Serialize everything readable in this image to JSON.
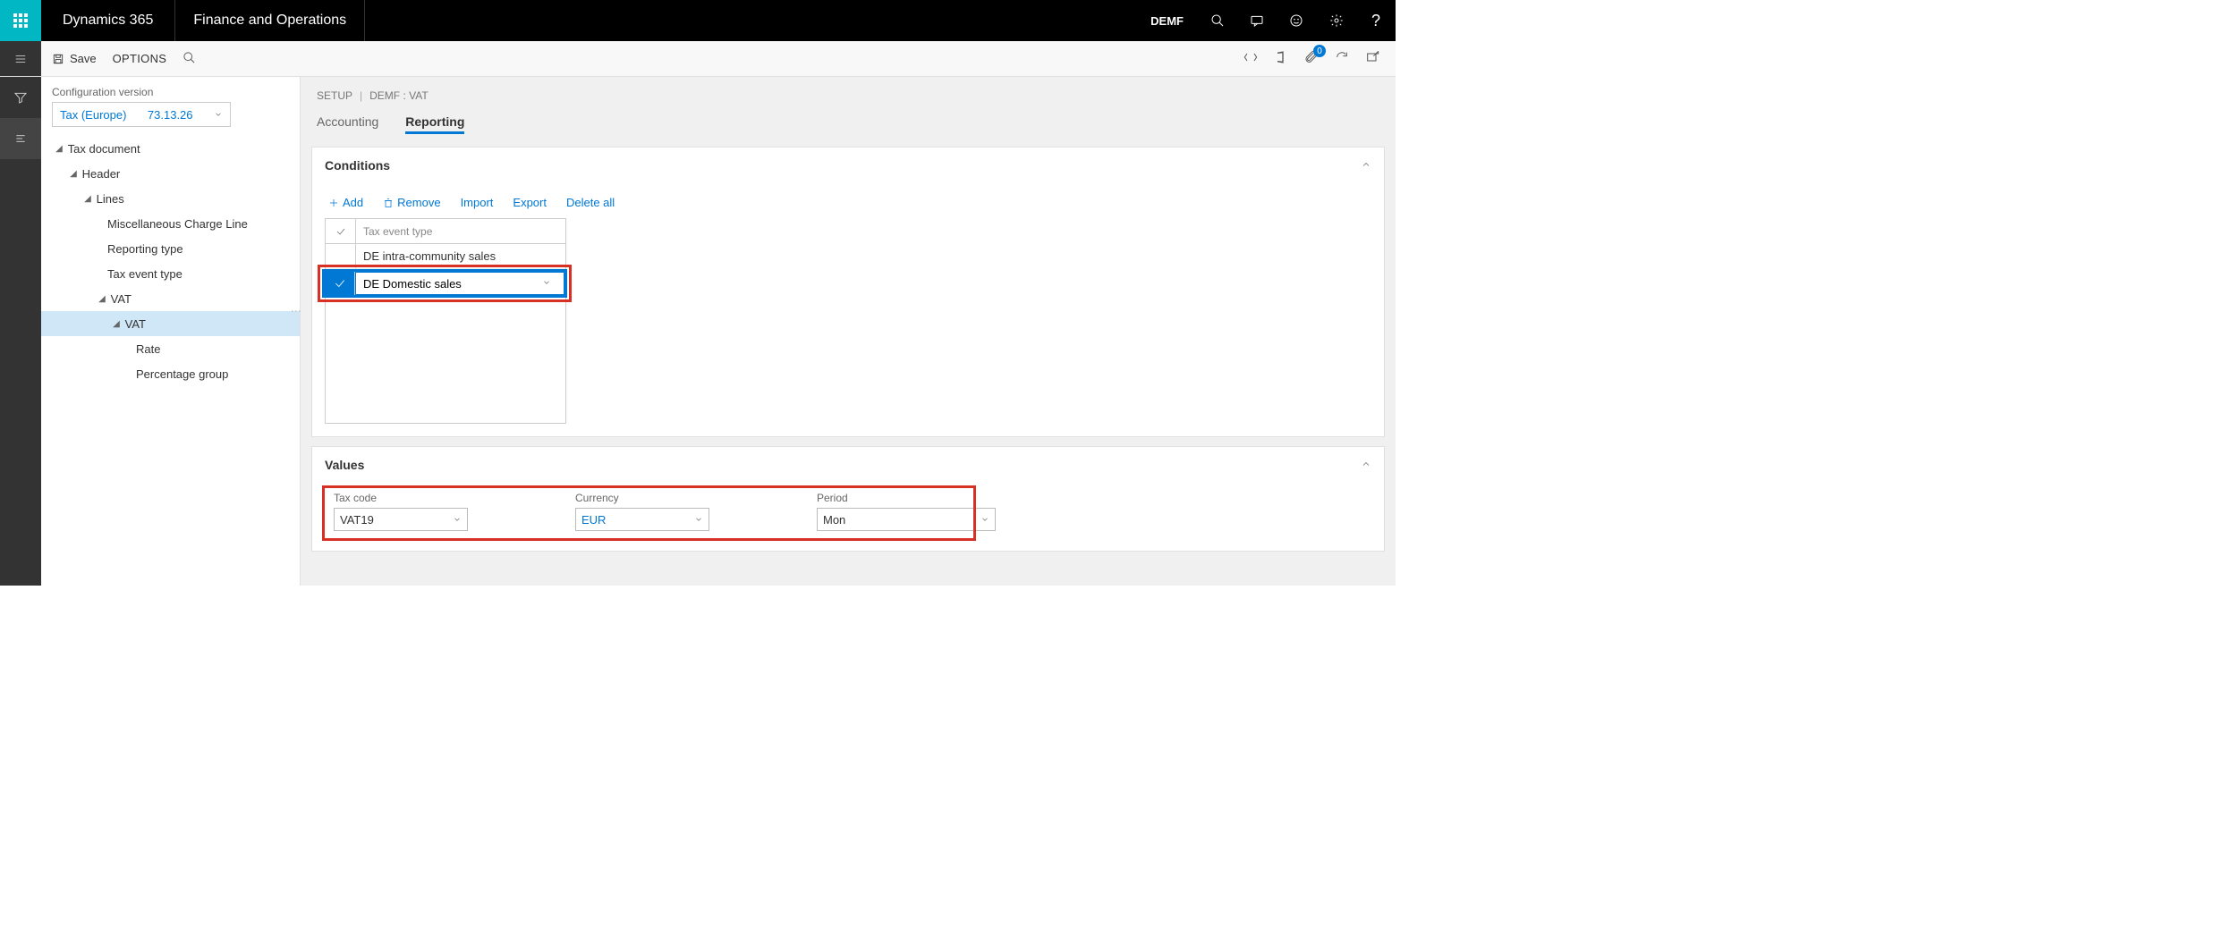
{
  "header": {
    "brand": "Dynamics 365",
    "app": "Finance and Operations",
    "company": "DEMF"
  },
  "actionbar": {
    "save": "Save",
    "options": "OPTIONS",
    "badge_count": "0"
  },
  "sidebar": {
    "config_label": "Configuration version",
    "config_name": "Tax (Europe)",
    "config_version": "73.13.26",
    "tree": {
      "root": "Tax document",
      "header": "Header",
      "lines": "Lines",
      "items": {
        "misc": "Miscellaneous Charge Line",
        "reporting_type": "Reporting type",
        "tax_event_type": "Tax event type",
        "vat_group": "VAT",
        "vat": "VAT",
        "rate": "Rate",
        "pct_group": "Percentage group"
      }
    }
  },
  "breadcrumb": {
    "setup": "SETUP",
    "company_ctx": "DEMF : VAT"
  },
  "tabs": {
    "accounting": "Accounting",
    "reporting": "Reporting"
  },
  "conditions": {
    "title": "Conditions",
    "add": "Add",
    "remove": "Remove",
    "import": "Import",
    "export": "Export",
    "delete_all": "Delete all",
    "column_header": "Tax event type",
    "row1": "DE intra-community sales",
    "row2_value": "DE Domestic sales"
  },
  "values": {
    "title": "Values",
    "tax_code_label": "Tax code",
    "tax_code_value": "VAT19",
    "currency_label": "Currency",
    "currency_value": "EUR",
    "period_label": "Period",
    "period_value": "Mon"
  }
}
